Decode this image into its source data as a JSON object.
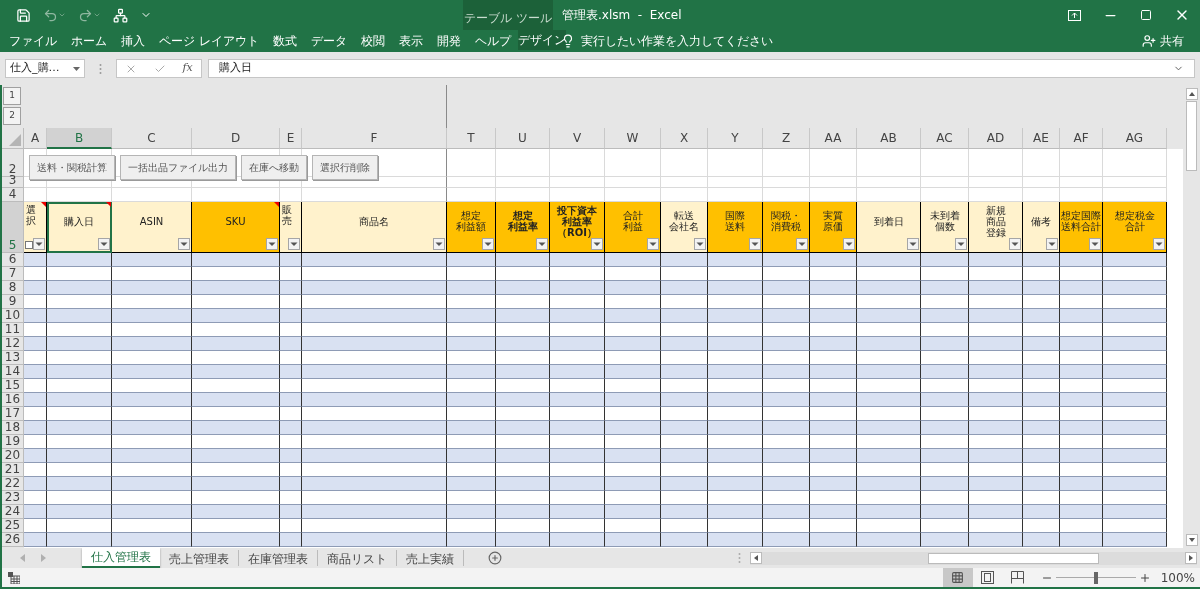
{
  "title_bar": {
    "title": "管理表.xlsm  -  Excel",
    "context_label": "テーブル ツール",
    "quick_access": [
      {
        "kind": "save",
        "disabled": false
      },
      {
        "kind": "undo",
        "disabled": true
      },
      {
        "kind": "redo",
        "disabled": true
      },
      {
        "kind": "tree",
        "disabled": false
      },
      {
        "kind": "customize",
        "disabled": false
      }
    ]
  },
  "ribbon": {
    "tabs": [
      {
        "label": "ファイル",
        "kind": "normal"
      },
      {
        "label": "ホーム",
        "kind": "normal"
      },
      {
        "label": "挿入",
        "kind": "normal"
      },
      {
        "label": "ページ レイアウト",
        "kind": "normal"
      },
      {
        "label": "数式",
        "kind": "normal"
      },
      {
        "label": "データ",
        "kind": "normal"
      },
      {
        "label": "校閲",
        "kind": "normal"
      },
      {
        "label": "表示",
        "kind": "normal"
      },
      {
        "label": "開発",
        "kind": "normal"
      },
      {
        "label": "ヘルプ",
        "kind": "normal"
      },
      {
        "label": "デザイン",
        "kind": "contextual"
      }
    ],
    "tell_me": "実行したい作業を入力してください",
    "share": "共有"
  },
  "formula_bar": {
    "name_box": "仕入_購…",
    "function_label": "fx",
    "formula": "購入日"
  },
  "outline_levels": [
    "1",
    "2"
  ],
  "columns": [
    {
      "letter": "A",
      "selected": false
    },
    {
      "letter": "B",
      "selected": true
    },
    {
      "letter": "C",
      "selected": false
    },
    {
      "letter": "D",
      "selected": false
    },
    {
      "letter": "E",
      "selected": false
    },
    {
      "letter": "F",
      "selected": false
    },
    {
      "letter": "T",
      "selected": false
    },
    {
      "letter": "U",
      "selected": false
    },
    {
      "letter": "V",
      "selected": false
    },
    {
      "letter": "W",
      "selected": false
    },
    {
      "letter": "X",
      "selected": false
    },
    {
      "letter": "Y",
      "selected": false
    },
    {
      "letter": "Z",
      "selected": false
    },
    {
      "letter": "AA",
      "selected": false
    },
    {
      "letter": "AB",
      "selected": false
    },
    {
      "letter": "AC",
      "selected": false
    },
    {
      "letter": "AD",
      "selected": false
    },
    {
      "letter": "AE",
      "selected": false
    },
    {
      "letter": "AF",
      "selected": false
    },
    {
      "letter": "AG",
      "selected": false
    }
  ],
  "macro_buttons": [
    "送料・関税計算",
    "一括出品ファイル出力",
    "在庫へ移動",
    "選択行削除"
  ],
  "rows_above": [
    "2",
    "3",
    "4"
  ],
  "header_row": {
    "number": "5",
    "selected": true,
    "cells": [
      {
        "kind": "checkbox",
        "lines": [
          "選択"
        ],
        "checked": false,
        "color": "#fff2cc",
        "bold": false,
        "comment": true,
        "selected": false
      },
      {
        "kind": "label",
        "lines": [
          "購入日"
        ],
        "color": "#fff2cc",
        "bold": false,
        "comment": true,
        "selected": true
      },
      {
        "kind": "label",
        "lines": [
          "ASIN"
        ],
        "color": "#fff2cc",
        "bold": false,
        "comment": false,
        "selected": false
      },
      {
        "kind": "label",
        "lines": [
          "SKU"
        ],
        "color": "#ffc000",
        "bold": false,
        "comment": true,
        "selected": false
      },
      {
        "kind": "label",
        "lines": [
          "販売"
        ],
        "color": "#fff2cc",
        "bold": false,
        "comment": false,
        "selected": false
      },
      {
        "kind": "label",
        "lines": [
          "商品名"
        ],
        "color": "#fff2cc",
        "bold": false,
        "comment": false,
        "selected": false
      },
      {
        "kind": "label",
        "lines": [
          "想定",
          "利益額"
        ],
        "color": "#ffc000",
        "bold": false,
        "comment": false,
        "selected": false
      },
      {
        "kind": "label",
        "lines": [
          "想定",
          "利益率"
        ],
        "color": "#ffc000",
        "bold": true,
        "comment": false,
        "selected": false
      },
      {
        "kind": "label",
        "lines": [
          "投下資本",
          "利益率",
          "（ROI）"
        ],
        "color": "#ffc000",
        "bold": true,
        "comment": false,
        "selected": false
      },
      {
        "kind": "label",
        "lines": [
          "合計",
          "利益"
        ],
        "color": "#ffc000",
        "bold": false,
        "comment": false,
        "selected": false
      },
      {
        "kind": "label",
        "lines": [
          "転送",
          "会社名"
        ],
        "color": "#fff2cc",
        "bold": false,
        "comment": false,
        "selected": false
      },
      {
        "kind": "label",
        "lines": [
          "国際",
          "送料"
        ],
        "color": "#ffc000",
        "bold": false,
        "comment": false,
        "selected": false
      },
      {
        "kind": "label",
        "lines": [
          "関税・",
          "消費税"
        ],
        "color": "#ffc000",
        "bold": false,
        "comment": false,
        "selected": false
      },
      {
        "kind": "label",
        "lines": [
          "実質",
          "原価"
        ],
        "color": "#ffc000",
        "bold": false,
        "comment": false,
        "selected": false
      },
      {
        "kind": "label",
        "lines": [
          "到着日"
        ],
        "color": "#fff2cc",
        "bold": false,
        "comment": false,
        "selected": false
      },
      {
        "kind": "label",
        "lines": [
          "未到着",
          "個数"
        ],
        "color": "#fff2cc",
        "bold": false,
        "comment": false,
        "selected": false
      },
      {
        "kind": "label",
        "lines": [
          "新規",
          "商品",
          "登録"
        ],
        "color": "#fff2cc",
        "bold": false,
        "comment": false,
        "selected": false
      },
      {
        "kind": "label",
        "lines": [
          "備考"
        ],
        "color": "#fff2cc",
        "bold": false,
        "comment": false,
        "selected": false
      },
      {
        "kind": "label",
        "lines": [
          "想定国際",
          "送料合計"
        ],
        "color": "#ffc000",
        "bold": false,
        "comment": false,
        "selected": false
      },
      {
        "kind": "label",
        "lines": [
          "想定税金",
          "合計"
        ],
        "color": "#ffc000",
        "bold": false,
        "comment": false,
        "selected": false
      }
    ]
  },
  "data_rows": [
    {
      "number": "6",
      "banded": true
    },
    {
      "number": "7",
      "banded": false
    },
    {
      "number": "8",
      "banded": true
    },
    {
      "number": "9",
      "banded": false
    },
    {
      "number": "10",
      "banded": true
    },
    {
      "number": "11",
      "banded": false
    },
    {
      "number": "12",
      "banded": true
    },
    {
      "number": "13",
      "banded": false
    },
    {
      "number": "14",
      "banded": true
    },
    {
      "number": "15",
      "banded": false
    },
    {
      "number": "16",
      "banded": true
    },
    {
      "number": "17",
      "banded": false
    },
    {
      "number": "18",
      "banded": true
    },
    {
      "number": "19",
      "banded": false
    },
    {
      "number": "20",
      "banded": true
    },
    {
      "number": "21",
      "banded": false
    },
    {
      "number": "22",
      "banded": true
    },
    {
      "number": "23",
      "banded": false
    },
    {
      "number": "24",
      "banded": true
    },
    {
      "number": "25",
      "banded": false
    },
    {
      "number": "26",
      "banded": true
    }
  ],
  "sheet_tabs": [
    {
      "label": "仕入管理表",
      "selected": true
    },
    {
      "label": "売上管理表",
      "selected": false
    },
    {
      "label": "在庫管理表",
      "selected": false
    },
    {
      "label": "商品リスト",
      "selected": false
    },
    {
      "label": "売上実績",
      "selected": false
    }
  ],
  "status_bar": {
    "view_buttons": [
      {
        "kind": "normal",
        "selected": true
      },
      {
        "kind": "page_layout",
        "selected": false
      },
      {
        "kind": "page_break",
        "selected": false
      }
    ],
    "zoom": {
      "level": 0.5,
      "reading": "100%"
    }
  }
}
